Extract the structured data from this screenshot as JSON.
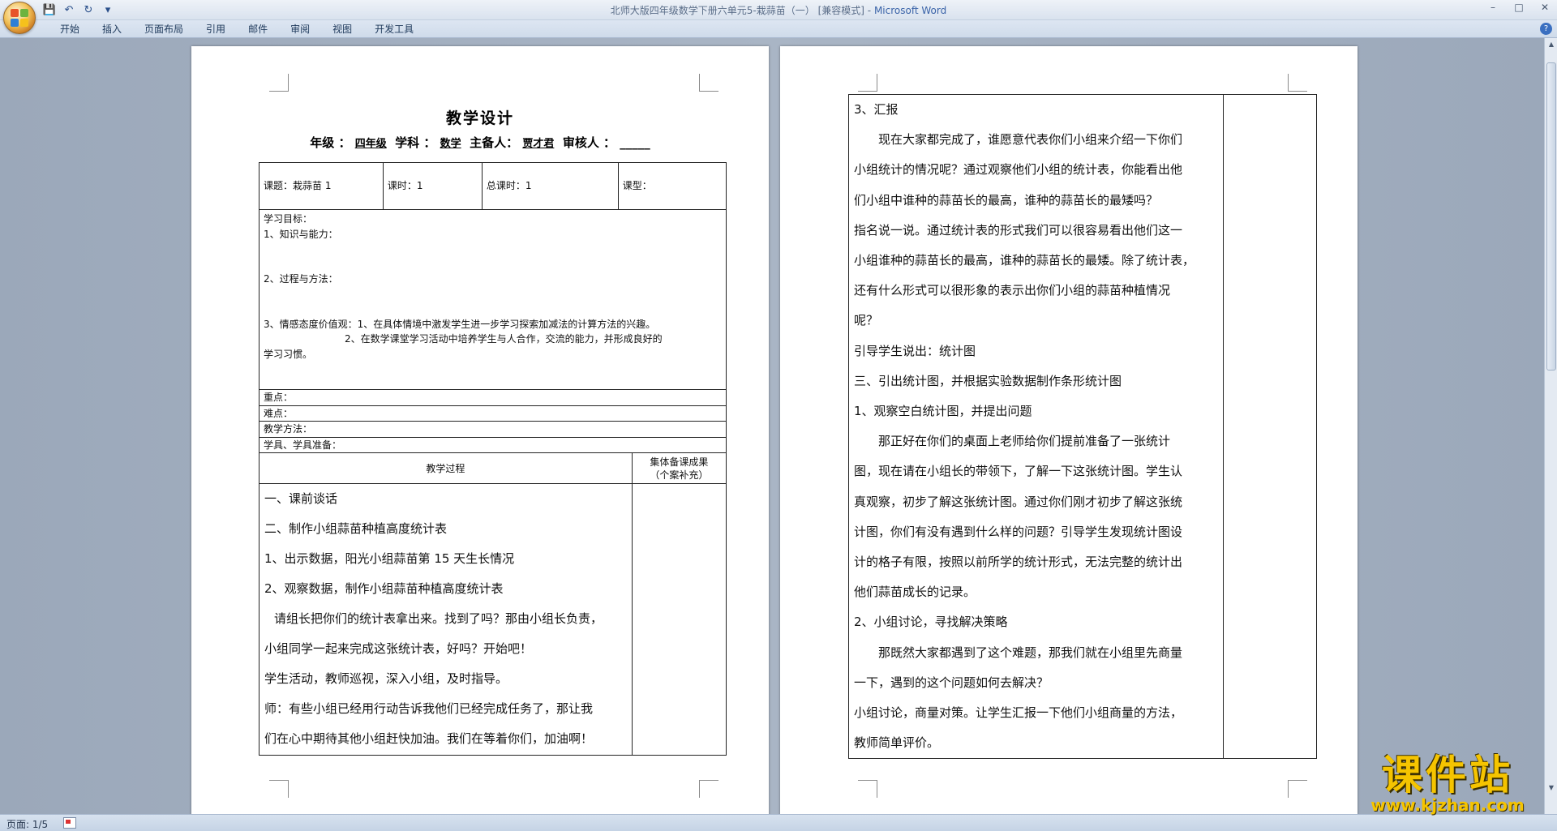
{
  "window": {
    "doc_name": "北师大版四年级数学下册六单元5-栽蒜苗（一）",
    "mode": "[兼容模式]",
    "separator": "-",
    "app": "Microsoft Word",
    "controls": [
      "–",
      "□",
      "✕"
    ]
  },
  "qat": {
    "save": "💾",
    "undo": "↶",
    "redo": "↻",
    "more": "▾"
  },
  "ribbon_tabs": [
    "开始",
    "插入",
    "页面布局",
    "引用",
    "邮件",
    "审阅",
    "视图",
    "开发工具"
  ],
  "help": "?",
  "page1": {
    "title": "教学设计",
    "header": {
      "grade_label": "年级 ：",
      "grade_value": "四年级",
      "subject_label": "学科 ：",
      "subject_value": "数学",
      "preparer_label": "主备人：",
      "preparer_value": "贾才君",
      "reviewer_label": "审核人 ：",
      "reviewer_value": "_____"
    },
    "info_row": {
      "topic": "课题：栽蒜苗 1",
      "hours": "课时：1",
      "total_hours": "总课时：1",
      "type": "课型："
    },
    "goals": {
      "heading": "学习目标：",
      "item1": "1、知识与能力：",
      "item2": "2、过程与方法：",
      "item3": "3、情感态度价值观：1、在具体情境中激发学生进一步学习探索加减法的计算方法的兴趣。",
      "item3b": "2、在数学课堂学习活动中培养学生与人合作，交流的能力，并形成良好的",
      "item3c": "学习习惯。"
    },
    "rows": {
      "key": "重点：",
      "difficult": "难点：",
      "method": "教学方法：",
      "tools": "学具、学具准备："
    },
    "process_header": "教学过程",
    "collective_header_1": "集体备课成果",
    "collective_header_2": "（个案补充）",
    "process_lines": [
      "一、课前谈话",
      "二、制作小组蒜苗种植高度统计表",
      "1、出示数据，阳光小组蒜苗第 15 天生长情况",
      "2、观察数据，制作小组蒜苗种植高度统计表",
      "请组长把你们的统计表拿出来。找到了吗？那由小组长负责，",
      "小组同学一起来完成这张统计表，好吗？开始吧！",
      "学生活动，教师巡视，深入小组，及时指导。",
      "师：有些小组已经用行动告诉我他们已经完成任务了，那让我",
      "们在心中期待其他小组赶快加油。我们在等着你们，加油啊！"
    ]
  },
  "page2": {
    "lines": [
      "3、汇报",
      "现在大家都完成了，谁愿意代表你们小组来介绍一下你们",
      "小组统计的情况呢？通过观察他们小组的统计表，你能看出他",
      "们小组中谁种的蒜苗长的最高，谁种的蒜苗长的最矮吗？",
      "指名说一说。通过统计表的形式我们可以很容易看出他们这一",
      "小组谁种的蒜苗长的最高，谁种的蒜苗长的最矮。除了统计表，",
      "还有什么形式可以很形象的表示出你们小组的蒜苗种植情况",
      "呢？",
      "引导学生说出：统计图",
      "三、引出统计图，并根据实验数据制作条形统计图",
      "1、观察空白统计图，并提出问题",
      "那正好在你们的桌面上老师给你们提前准备了一张统计",
      "图，现在请在小组长的带领下，了解一下这张统计图。学生认",
      "真观察，初步了解这张统计图。通过你们刚才初步了解这张统",
      "计图，你们有没有遇到什么样的问题？引导学生发现统计图设",
      "计的格子有限，按照以前所学的统计形式，无法完整的统计出",
      "他们蒜苗成长的记录。",
      "2、小组讨论，寻找解决策略",
      "那既然大家都遇到了这个难题，那我们就在小组里先商量",
      "一下，遇到的这个问题如何去解决？",
      "小组讨论，商量对策。让学生汇报一下他们小组商量的方法，",
      "教师简单评价。"
    ]
  },
  "status": {
    "page": "页面: 1/5"
  },
  "watermark": {
    "main": "课件站",
    "url": "www.kjzhan.com"
  },
  "colors": {
    "accent": "#3a63a8",
    "watermark": "#f5c400"
  }
}
